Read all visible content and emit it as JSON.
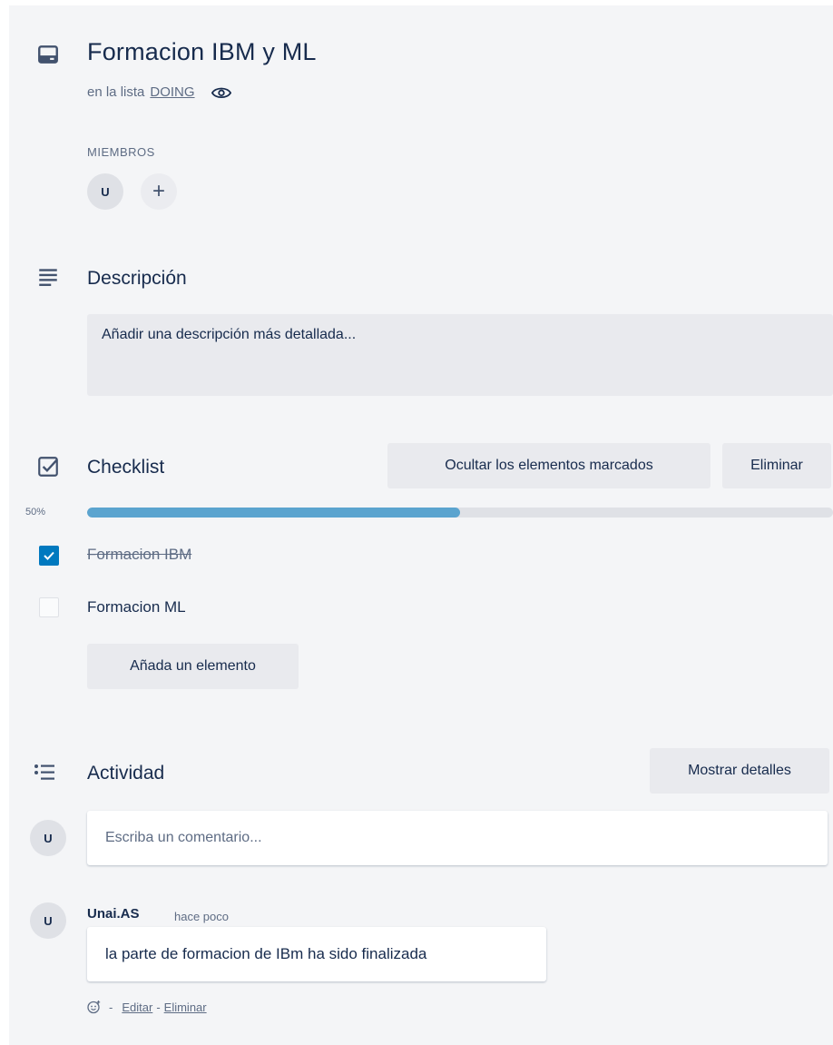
{
  "card": {
    "title": "Formacion IBM y ML",
    "list_prefix": "en la lista",
    "list_name": "DOING"
  },
  "members": {
    "label": "MIEMBROS",
    "avatar_initial": "U",
    "add_symbol": "+"
  },
  "description": {
    "title": "Descripción",
    "placeholder": "Añadir una descripción más detallada..."
  },
  "checklist": {
    "title": "Checklist",
    "hide_checked_label": "Ocultar los elementos marcados",
    "delete_label": "Eliminar",
    "progress_label": "50%",
    "progress_fraction": 0.5,
    "items": [
      {
        "text": "Formacion IBM",
        "checked": true
      },
      {
        "text": "Formacion ML",
        "checked": false
      }
    ],
    "add_item_label": "Añada un elemento"
  },
  "activity": {
    "title": "Actividad",
    "show_details_label": "Mostrar detalles",
    "comment_placeholder": "Escriba un comentario...",
    "current_user_initial": "U",
    "comments": [
      {
        "author_initial": "U",
        "author": "Unai.AS",
        "time": "hace poco",
        "text": "la parte de formacion de IBm ha sido finalizada",
        "separator": "-",
        "edit_label": "Editar",
        "delete_label": "Eliminar"
      }
    ]
  },
  "icons": {
    "card": "card-icon",
    "watch": "eye-icon",
    "description": "description-icon",
    "checklist": "checklist-icon",
    "activity": "activity-icon",
    "reaction": "add-reaction-icon",
    "check": "check-icon"
  },
  "colors": {
    "progress": "#5ba4cf",
    "checkbox_checked": "#0079bf",
    "background": "#f4f5f7"
  }
}
